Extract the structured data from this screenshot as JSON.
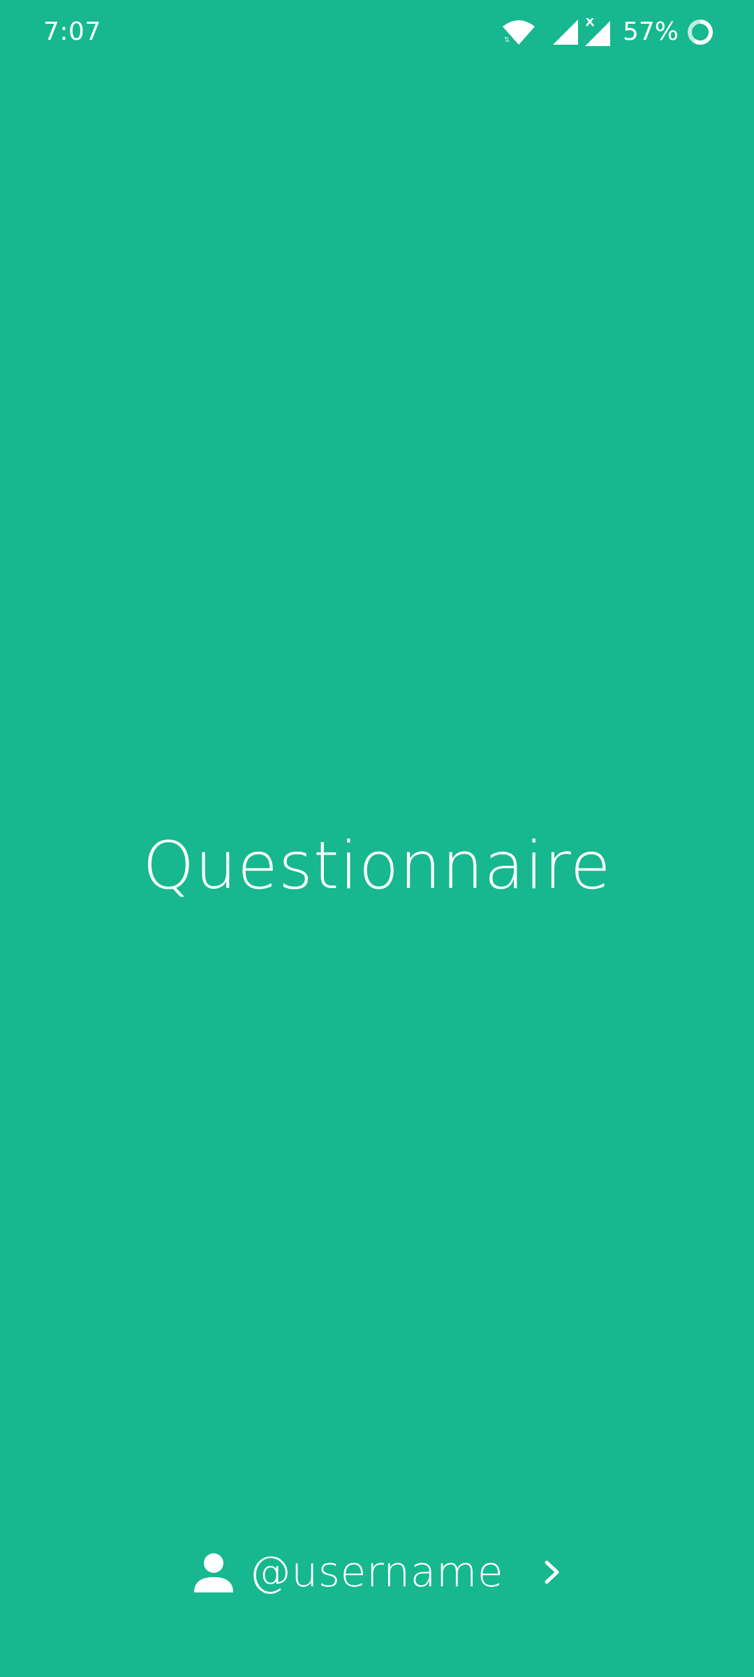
{
  "status_bar": {
    "time": "7:07",
    "battery": "57%",
    "icons": [
      "wifi-icon",
      "signal-icon",
      "signal-no-data-icon",
      "battery-ring-icon"
    ]
  },
  "main": {
    "title": "Questionnaire"
  },
  "footer": {
    "username": "@username",
    "icons": [
      "person-icon",
      "chevron-right-icon"
    ]
  },
  "colors": {
    "background": "#17b78f",
    "foreground": "#ffffff"
  }
}
